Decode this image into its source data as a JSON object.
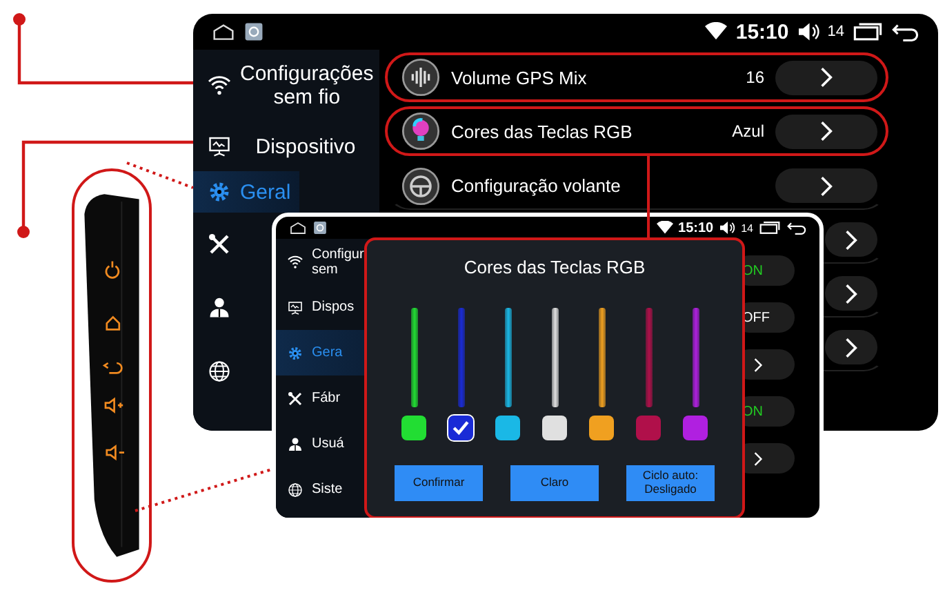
{
  "back_screen": {
    "status_bar": {
      "time": "15:10",
      "volume": "14"
    },
    "sidebar": [
      {
        "label": "Configurações sem fio",
        "selected": false
      },
      {
        "label": "Dispositivo",
        "selected": false
      },
      {
        "label": "Geral",
        "selected": true
      },
      {
        "selected": false
      },
      {
        "selected": false
      },
      {
        "selected": false
      }
    ],
    "rows": [
      {
        "kind": "full",
        "label": "Volume GPS Mix",
        "value": "16",
        "highlighted": true
      },
      {
        "kind": "full",
        "label": "Cores das Teclas RGB",
        "value": "Azul",
        "highlighted": true
      },
      {
        "kind": "full",
        "label": "Configuração volante",
        "highlighted": false
      },
      {
        "kind": "button"
      },
      {
        "kind": "button"
      },
      {
        "kind": "button"
      }
    ]
  },
  "front_screen": {
    "status_bar": {
      "time": "15:10",
      "volume": "14"
    },
    "sidebar": [
      {
        "label": "Configur sem",
        "selected": false
      },
      {
        "label": "Dispos",
        "selected": false
      },
      {
        "label": "Gera",
        "selected": true
      },
      {
        "label": "Fábr",
        "selected": false
      },
      {
        "label": "Usuá",
        "selected": false
      },
      {
        "label": "Siste",
        "selected": false
      }
    ],
    "rows": [
      {
        "kind": "toggle",
        "value": "ON",
        "on": true
      },
      {
        "kind": "toggle",
        "value": "OFF",
        "on": false
      },
      {
        "kind": "arrow"
      },
      {
        "kind": "toggle",
        "value": "ON",
        "on": true
      },
      {
        "kind": "arrow"
      }
    ],
    "dialog": {
      "title": "Cores das Teclas RGB",
      "colors": [
        {
          "color": "#22dd33",
          "selected": false
        },
        {
          "color": "#1a2bd6",
          "selected": true
        },
        {
          "color": "#1ab8e6",
          "selected": false
        },
        {
          "color": "#e0e0e0",
          "selected": false
        },
        {
          "color": "#f0a020",
          "selected": false
        },
        {
          "color": "#b0104a",
          "selected": false
        },
        {
          "color": "#b020e0",
          "selected": false
        }
      ],
      "buttons": [
        "Confirmar",
        "Claro",
        "Ciclo auto:\nDesligado"
      ]
    }
  }
}
